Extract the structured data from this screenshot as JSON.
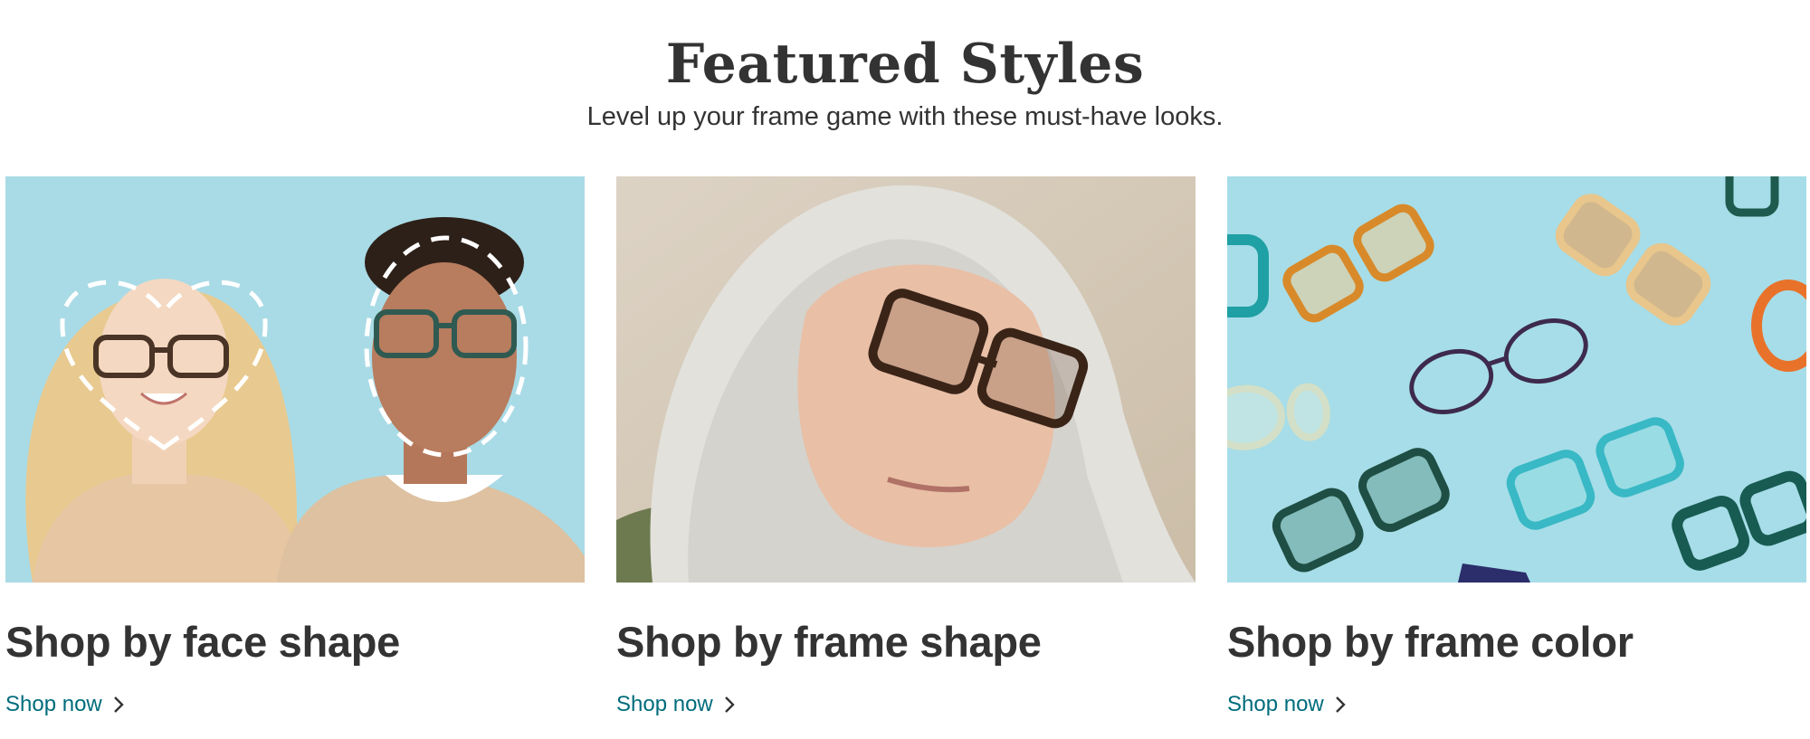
{
  "section": {
    "title": "Featured Styles",
    "subtitle": "Level up your frame game with these must-have looks."
  },
  "cards": [
    {
      "title": "Shop by face shape",
      "link_label": "Shop now",
      "link_icon": "chevron-right-icon"
    },
    {
      "title": "Shop by frame shape",
      "link_label": "Shop now",
      "link_icon": "chevron-right-icon"
    },
    {
      "title": "Shop by frame color",
      "link_label": "Shop now",
      "link_icon": "chevron-right-icon"
    }
  ],
  "colors": {
    "text": "#333333",
    "link": "#006c7c",
    "card1_bg": "#a9dbe6",
    "card2_bg": "#d7cbb9",
    "card3_bg": "#a6dde8"
  }
}
